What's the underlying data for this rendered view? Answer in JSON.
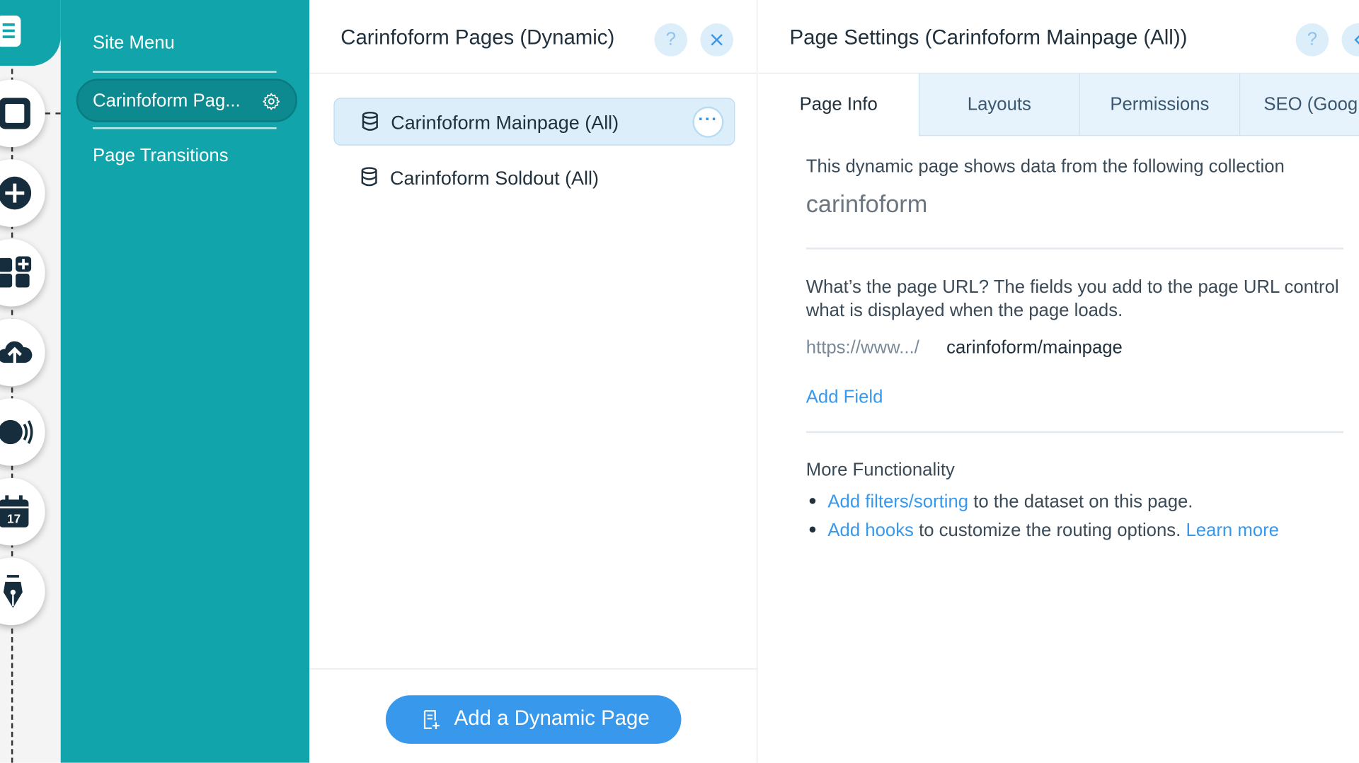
{
  "left_rail": {
    "tools": [
      "pages-icon",
      "layout-icon",
      "add-icon",
      "app-market-icon",
      "upload-icon",
      "chat-icon",
      "calendar-icon",
      "pen-icon"
    ],
    "calendar_day": "17"
  },
  "site_menu": {
    "title": "Site Menu",
    "active_item": "Carinfoform Pag...",
    "transitions": "Page Transitions"
  },
  "pages_panel": {
    "title": "Carinfoform Pages (Dynamic)",
    "help": "?",
    "items": [
      {
        "label": "Carinfoform Mainpage (All)",
        "selected": true
      },
      {
        "label": "Carinfoform Soldout (All)",
        "selected": false
      }
    ],
    "more": "···",
    "add_button": "Add a Dynamic Page"
  },
  "settings_panel": {
    "title": "Page Settings (Carinfoform Mainpage (All))",
    "help": "?",
    "tabs": [
      "Page Info",
      "Layouts",
      "Permissions",
      "SEO (Goog"
    ],
    "active_tab": 0,
    "collection_intro": "This dynamic page shows data from the following collection",
    "collection_name": "carinfoform",
    "url_question_line1": "What’s the page URL? The fields you add to the page URL control",
    "url_question_line2": "what is displayed when the page loads.",
    "url_prefix": "https://www.../",
    "url_value": "carinfoform/mainpage",
    "add_field": "Add Field",
    "more_functionality": "More Functionality",
    "bullet1_link": "Add filters/sorting",
    "bullet1_text": " to the dataset on this page.",
    "bullet2_link": "Add hooks",
    "bullet2_text": " to customize the routing options. ",
    "bullet2_learn": "Learn more"
  },
  "colors": {
    "site_menu_bg": "#11a5ab",
    "accent": "#3899ec",
    "selected_bg": "#dceefa"
  }
}
